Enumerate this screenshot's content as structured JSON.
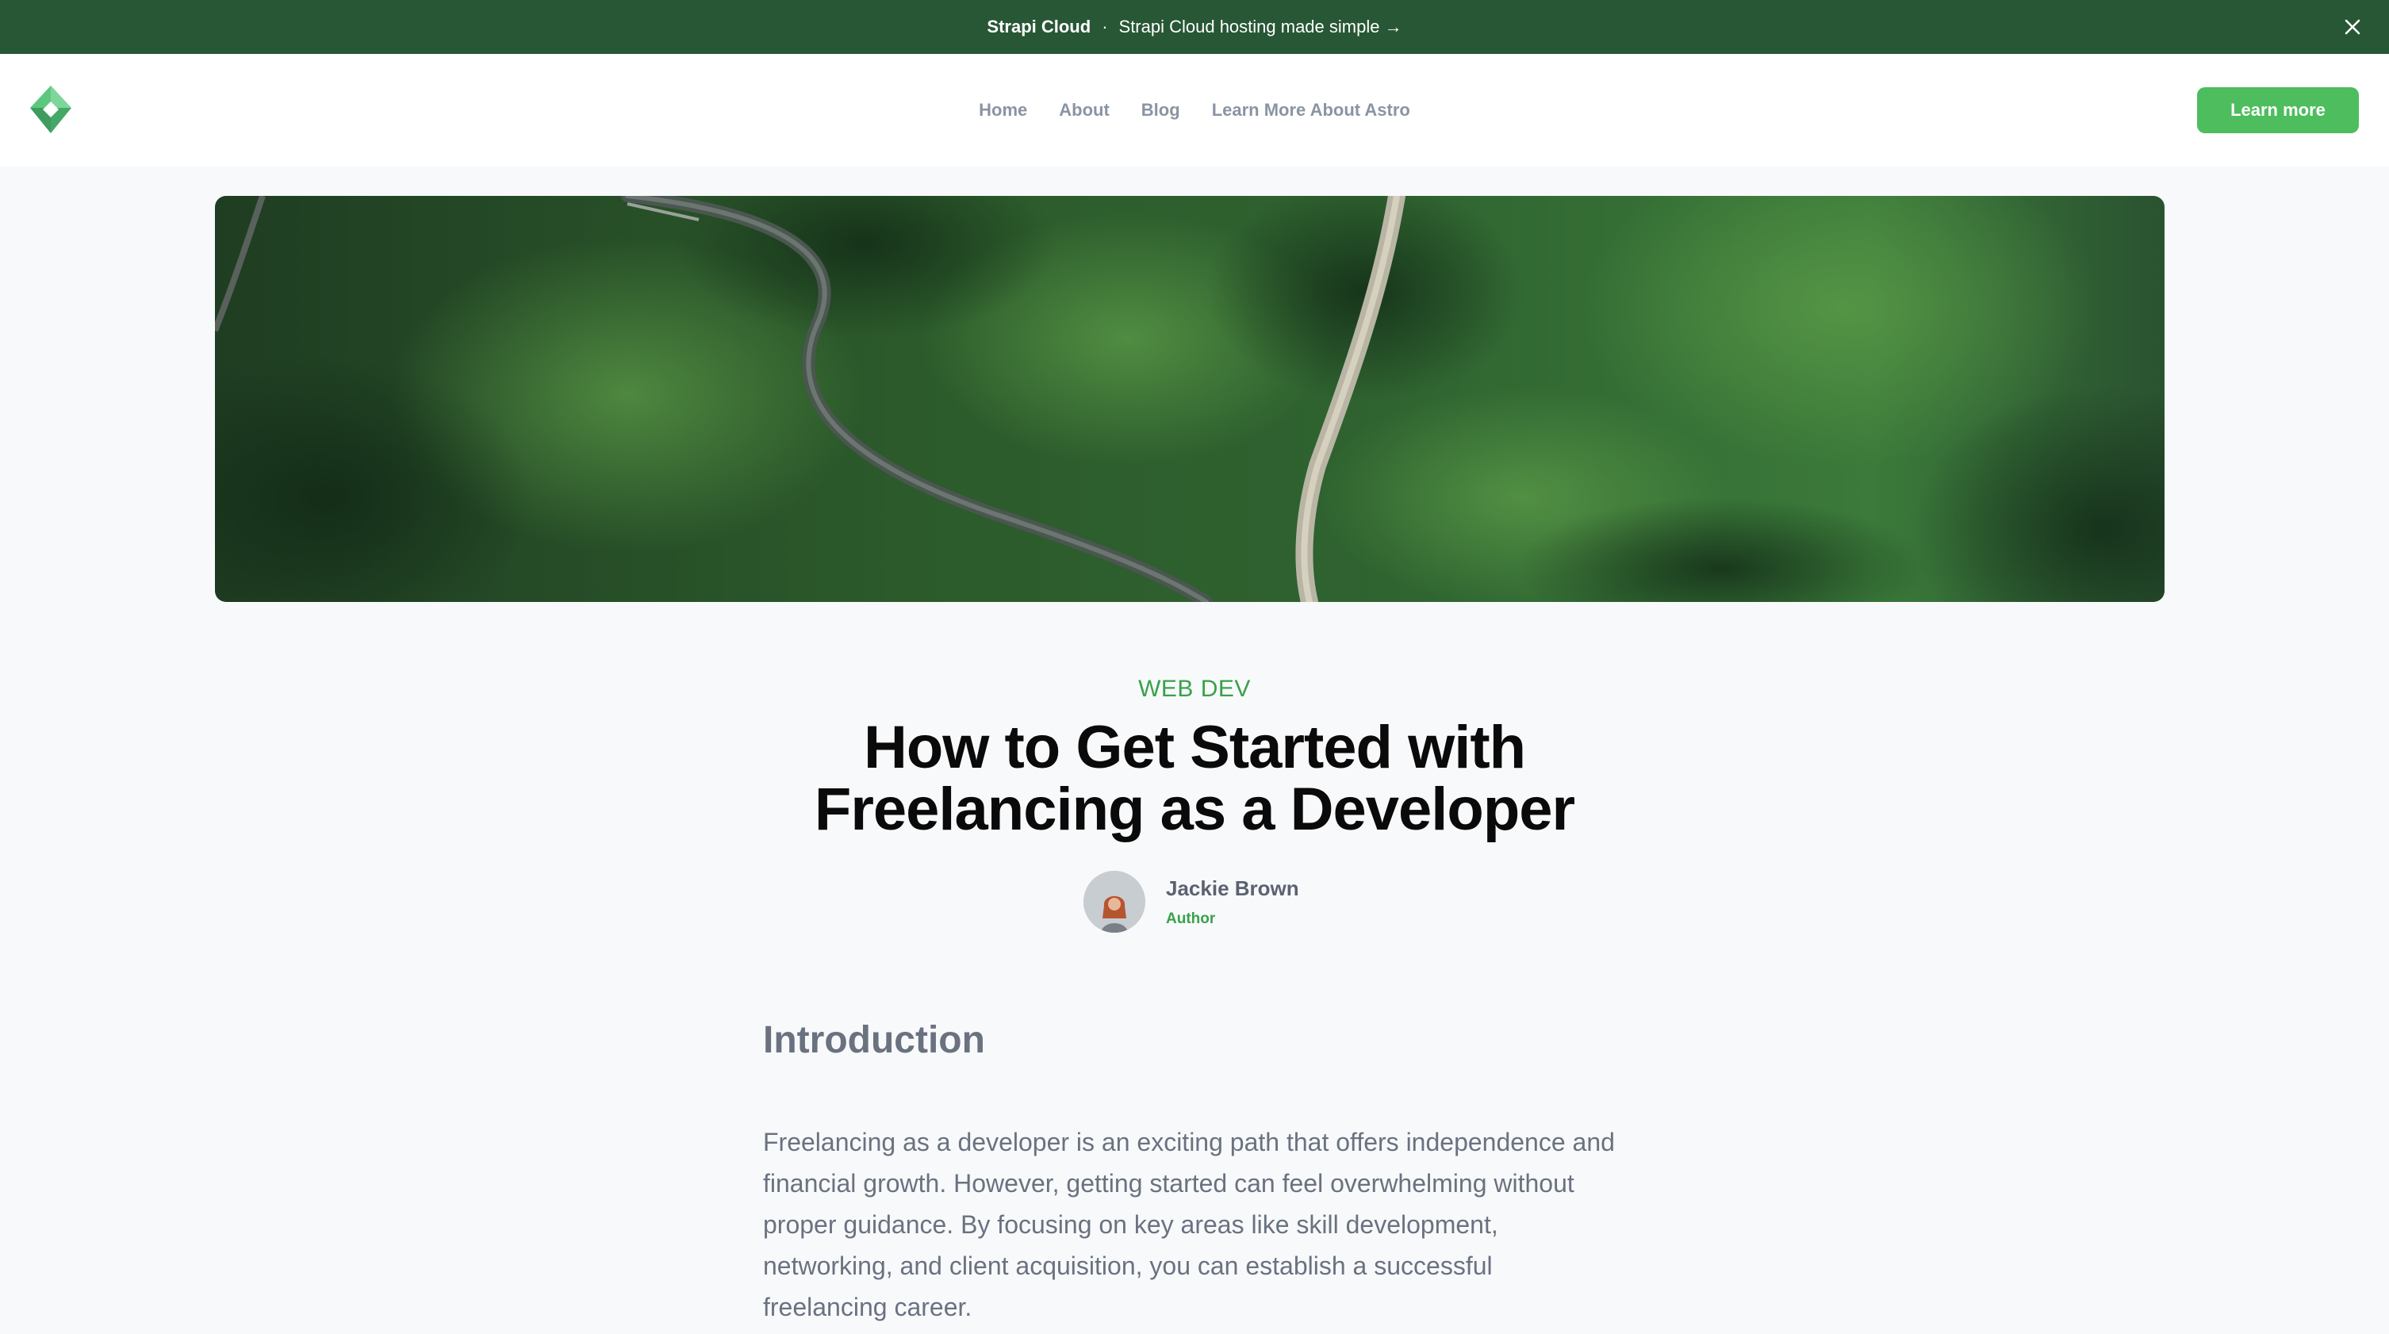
{
  "banner": {
    "brand": "Strapi Cloud",
    "separator": "·",
    "message": "Strapi Cloud hosting made simple →"
  },
  "nav": {
    "links": [
      "Home",
      "About",
      "Blog",
      "Learn More About Astro"
    ],
    "cta_label": "Learn more"
  },
  "article": {
    "category": "WEB DEV",
    "title_line1": "How to Get Started with",
    "title_line2": "Freelancing as a Developer",
    "author_name": "Jackie Brown",
    "author_role": "Author",
    "section_heading": "Introduction",
    "intro_paragraph": "Freelancing as a developer is an exciting path that offers independence and financial growth. However, getting started can feel overwhelming without proper guidance. By focusing on key areas like skill development, networking, and client acquisition, you can establish a successful freelancing career."
  },
  "colors": {
    "banner_bg": "#285736",
    "accent_green": "#4dbd5e",
    "category_green": "#39a14a",
    "page_bg": "#f8f9fb",
    "muted_text": "#6a7280"
  },
  "icons": {
    "logo": "strapi-diamond-logo",
    "close": "close-icon",
    "hero": "aerial-forest-road-image",
    "avatar": "author-avatar"
  }
}
